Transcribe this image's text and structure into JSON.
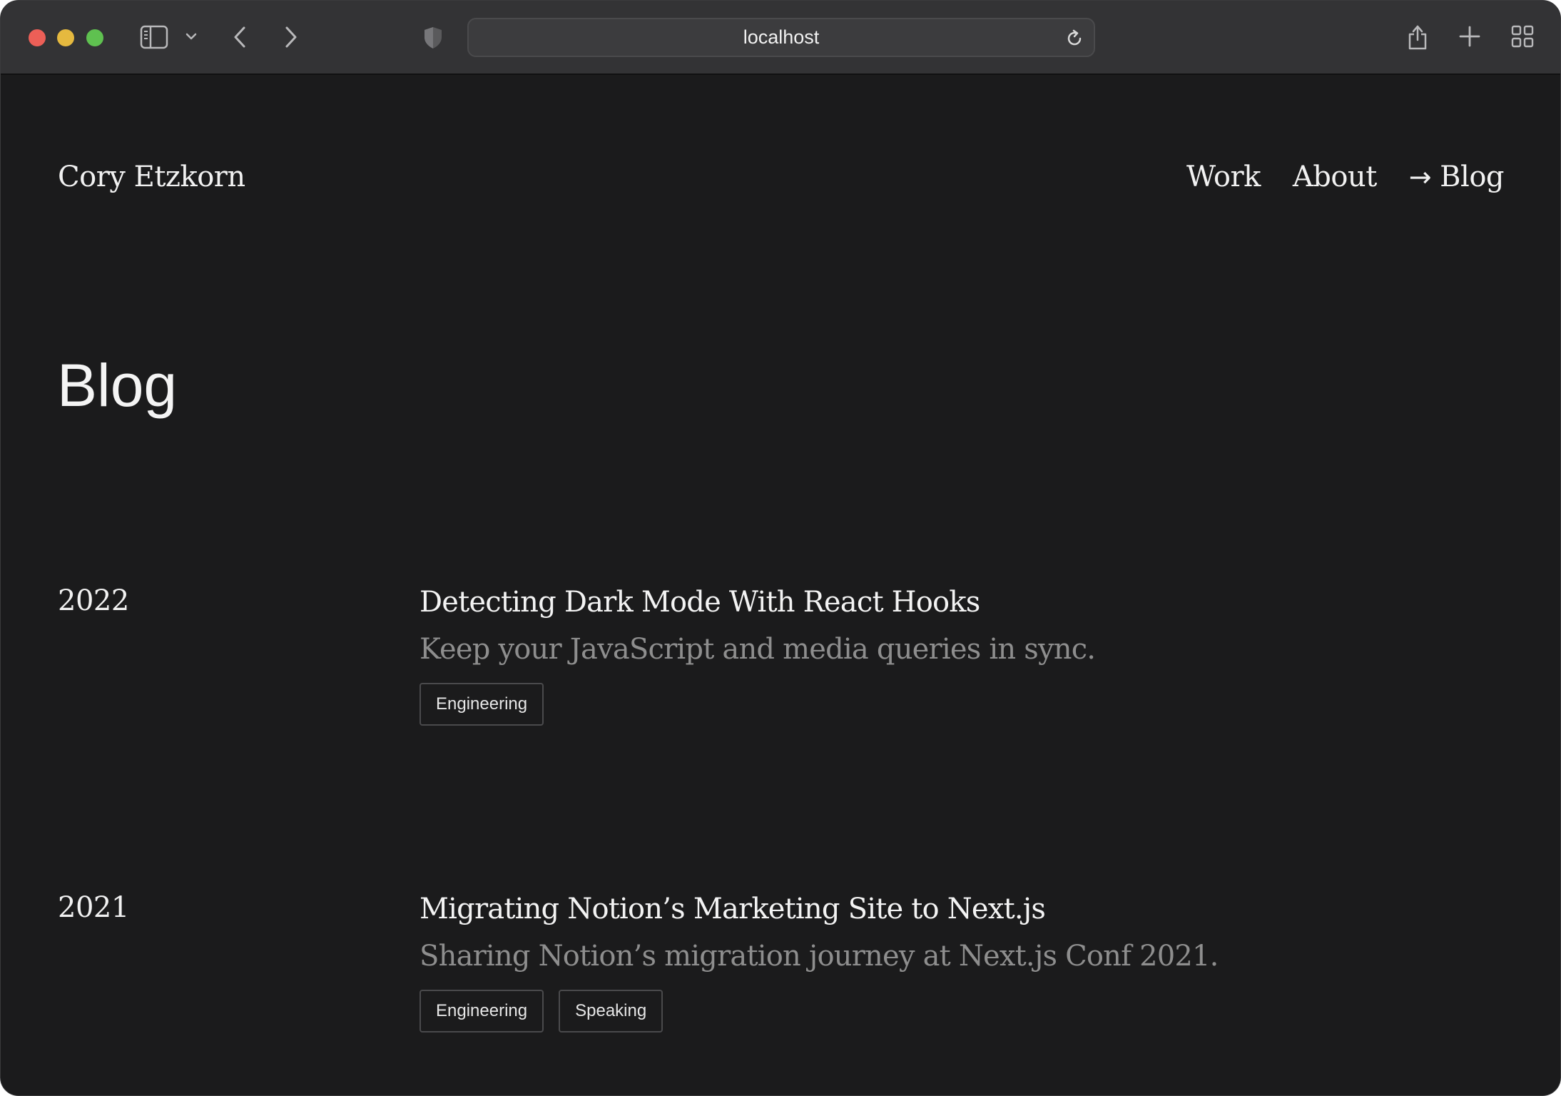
{
  "browser": {
    "url": "localhost",
    "icons": [
      "sidebar-icon",
      "chevron-down-icon",
      "back-icon",
      "forward-icon",
      "shield-icon",
      "reload-icon",
      "share-icon",
      "plus-icon",
      "tabs-grid-icon"
    ]
  },
  "header": {
    "site_name": "Cory Etzkorn",
    "nav": [
      {
        "label": "Work",
        "active": false
      },
      {
        "label": "About",
        "active": false
      },
      {
        "label": "Blog",
        "active": true,
        "prefix": "→"
      }
    ]
  },
  "main": {
    "title": "Blog",
    "posts": [
      {
        "year": "2022",
        "title": "Detecting Dark Mode With React Hooks",
        "description": "Keep your JavaScript and media queries in sync.",
        "tags": [
          "Engineering"
        ]
      },
      {
        "year": "2021",
        "title": "Migrating Notion’s Marketing Site to Next.js",
        "description": "Sharing Notion’s migration journey at Next.js Conf 2021.",
        "tags": [
          "Engineering",
          "Speaking"
        ]
      }
    ]
  },
  "colors": {
    "background": "#1b1b1c",
    "toolbar": "#333335",
    "text": "#f1f1f1",
    "muted_text": "#8e8e8e"
  }
}
